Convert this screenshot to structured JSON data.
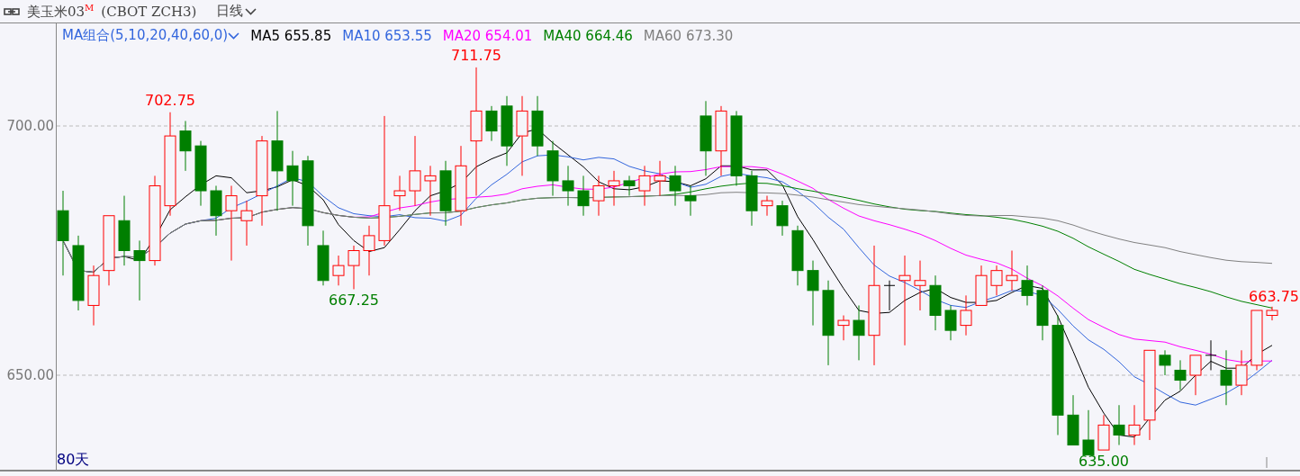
{
  "title_bar": {
    "name": "美玉米03$^{M}$",
    "code": "(CBOT ZCH3)",
    "period": "日线"
  },
  "legend": [
    {
      "label": "MA组合(5,10,20,40,60,0)",
      "kind": "group",
      "color": "#3366dd"
    },
    {
      "label": "MA5 655.85",
      "kind": "ma",
      "color": "#000000"
    },
    {
      "label": "MA10 653.55",
      "kind": "ma",
      "color": "#3366dd"
    },
    {
      "label": "MA20 654.01",
      "kind": "ma",
      "color": "#ff00ff"
    },
    {
      "label": "MA40 664.46",
      "kind": "ma",
      "color": "#008000"
    },
    {
      "label": "MA60 673.30",
      "kind": "ma",
      "color": "#808080"
    }
  ],
  "y_axis": [
    {
      "label": "700.00"
    },
    {
      "label": "650.00"
    }
  ],
  "annotations": [
    {
      "text": "702.75",
      "kind": "high"
    },
    {
      "text": "711.75",
      "kind": "high"
    },
    {
      "text": "667.25",
      "kind": "low"
    },
    {
      "text": "635.00",
      "kind": "low"
    },
    {
      "text": "663.75",
      "kind": "last"
    }
  ],
  "range_label": "80天"
}
